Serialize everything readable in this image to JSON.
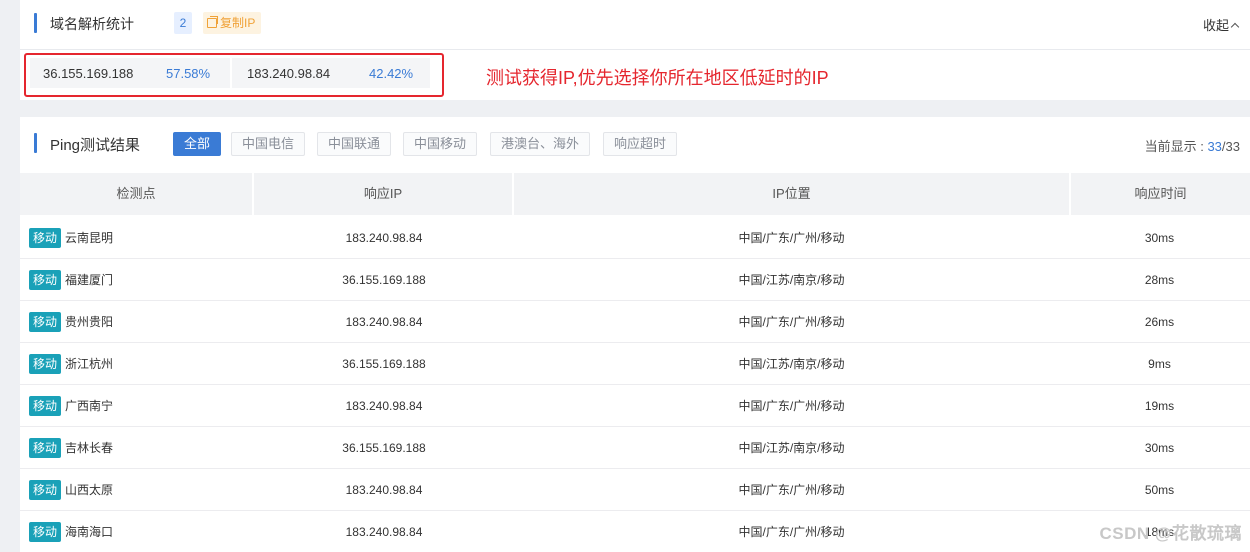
{
  "domain_panel": {
    "title": "域名解析统计",
    "count": "2",
    "copy_label": "复制IP",
    "collapse_label": "收起",
    "ips": [
      {
        "address": "36.155.169.188",
        "percent": "57.58%"
      },
      {
        "address": "183.240.98.84",
        "percent": "42.42%"
      }
    ]
  },
  "annotation": "测试获得IP,优先选择你所在地区低延时的IP",
  "ping_panel": {
    "title": "Ping测试结果",
    "filters": [
      "全部",
      "中国电信",
      "中国联通",
      "中国移动",
      "港澳台、海外",
      "响应超时"
    ],
    "current_label": "当前显示 : ",
    "current_shown": "33",
    "current_total": "/33",
    "columns": [
      "检测点",
      "响应IP",
      "IP位置",
      "响应时间"
    ],
    "rows": [
      {
        "isp": "移动",
        "location": "云南昆明",
        "ip": "183.240.98.84",
        "ip_location": "中国/广东/广州/移动",
        "time": "30ms"
      },
      {
        "isp": "移动",
        "location": "福建厦门",
        "ip": "36.155.169.188",
        "ip_location": "中国/江苏/南京/移动",
        "time": "28ms"
      },
      {
        "isp": "移动",
        "location": "贵州贵阳",
        "ip": "183.240.98.84",
        "ip_location": "中国/广东/广州/移动",
        "time": "26ms"
      },
      {
        "isp": "移动",
        "location": "浙江杭州",
        "ip": "36.155.169.188",
        "ip_location": "中国/江苏/南京/移动",
        "time": "9ms"
      },
      {
        "isp": "移动",
        "location": "广西南宁",
        "ip": "183.240.98.84",
        "ip_location": "中国/广东/广州/移动",
        "time": "19ms"
      },
      {
        "isp": "移动",
        "location": "吉林长春",
        "ip": "36.155.169.188",
        "ip_location": "中国/江苏/南京/移动",
        "time": "30ms"
      },
      {
        "isp": "移动",
        "location": "山西太原",
        "ip": "183.240.98.84",
        "ip_location": "中国/广东/广州/移动",
        "time": "50ms"
      },
      {
        "isp": "移动",
        "location": "海南海口",
        "ip": "183.240.98.84",
        "ip_location": "中国/广东/广州/移动",
        "time": "18ms"
      }
    ]
  },
  "watermark": "CSDN @花散琉璃",
  "colors": {
    "accent": "#3a7bd5",
    "annotation": "#e5262e",
    "isp_tag": "#1aa1b8",
    "copy": "#f0a238"
  }
}
